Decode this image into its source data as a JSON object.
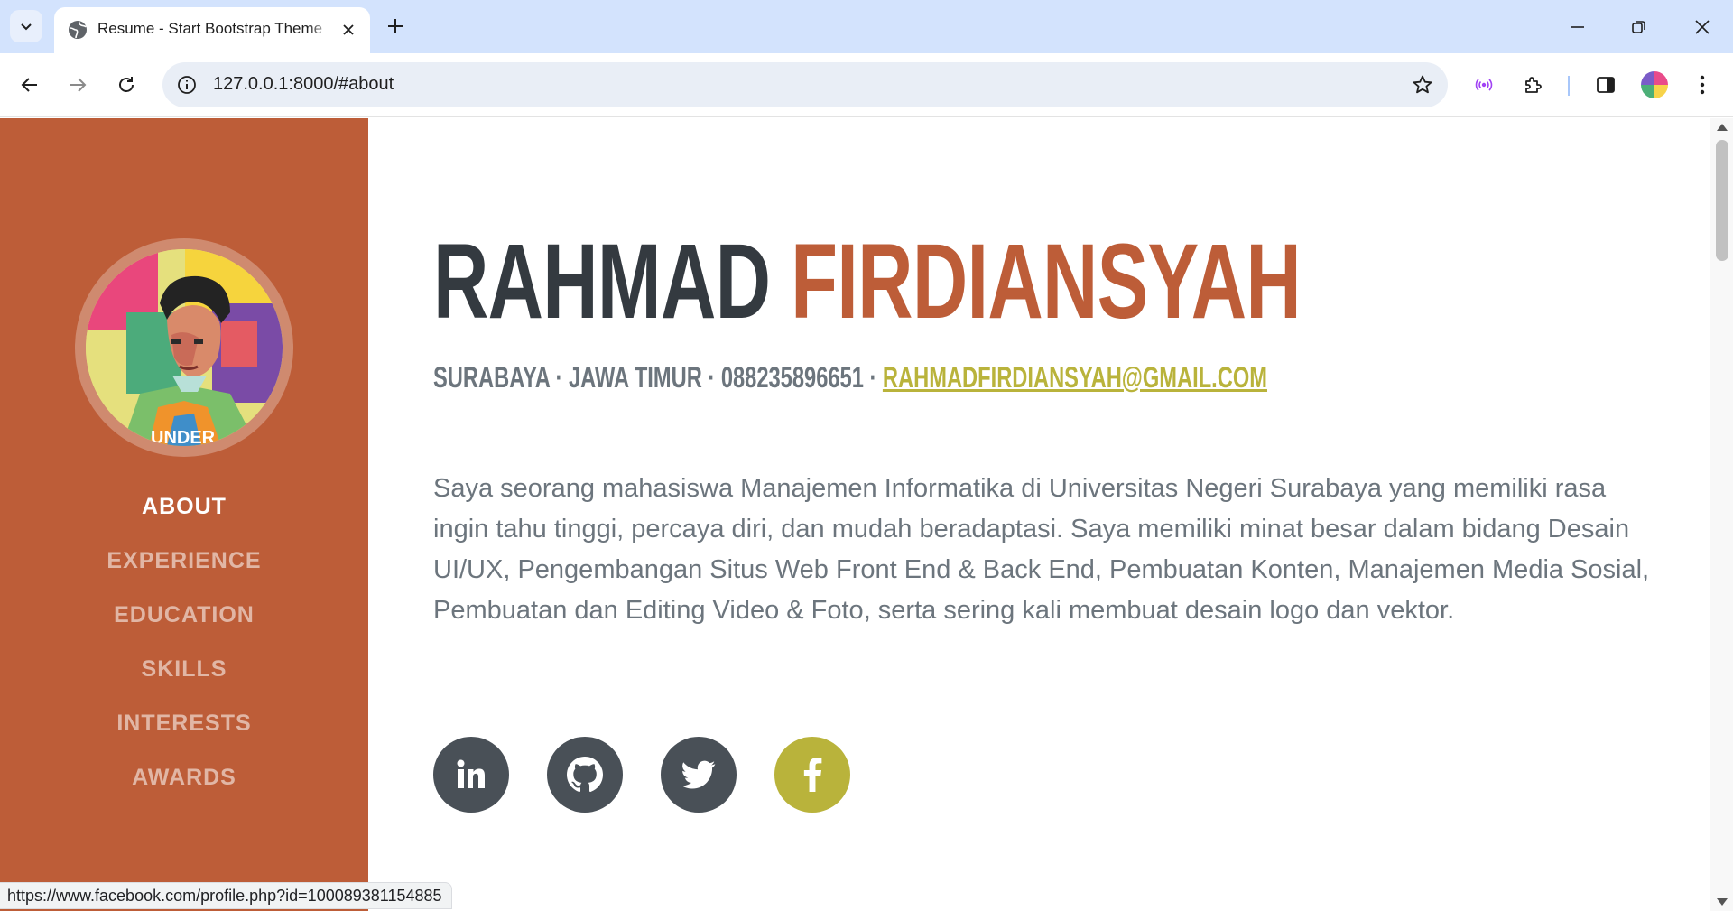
{
  "browser": {
    "tab_title": "Resume - Start Bootstrap Theme",
    "url": "127.0.0.1:8000/#about",
    "status_url": "https://www.facebook.com/profile.php?id=100089381154885"
  },
  "sidebar": {
    "nav": [
      {
        "label": "ABOUT",
        "active": true
      },
      {
        "label": "EXPERIENCE",
        "active": false
      },
      {
        "label": "EDUCATION",
        "active": false
      },
      {
        "label": "SKILLS",
        "active": false
      },
      {
        "label": "INTERESTS",
        "active": false
      },
      {
        "label": "AWARDS",
        "active": false
      }
    ]
  },
  "about": {
    "first_name": "RAHMAD",
    "last_name": "FIRDIANSYAH",
    "subheading_text": "SURABAYA · JAWA TIMUR · 088235896651 · ",
    "email": "RAHMADFIRDIANSYAH@GMAIL.COM",
    "description": "Saya seorang mahasiswa Manajemen Informatika di Universitas Negeri Surabaya yang memiliki rasa ingin tahu tinggi, percaya diri, dan mudah beradaptasi. Saya memiliki minat besar dalam bidang Desain UI/UX, Pengembangan Situs Web Front End & Back End, Pembuatan Konten, Manajemen Media Sosial, Pembuatan dan Editing Video & Foto, serta sering kali membuat desain logo dan vektor.",
    "social": [
      "linkedin-icon",
      "github-icon",
      "twitter-icon",
      "facebook-icon"
    ]
  },
  "colors": {
    "primary": "#bd5d38",
    "accent": "#b9b33b",
    "dark": "#343a40",
    "muted": "#6c757d"
  }
}
